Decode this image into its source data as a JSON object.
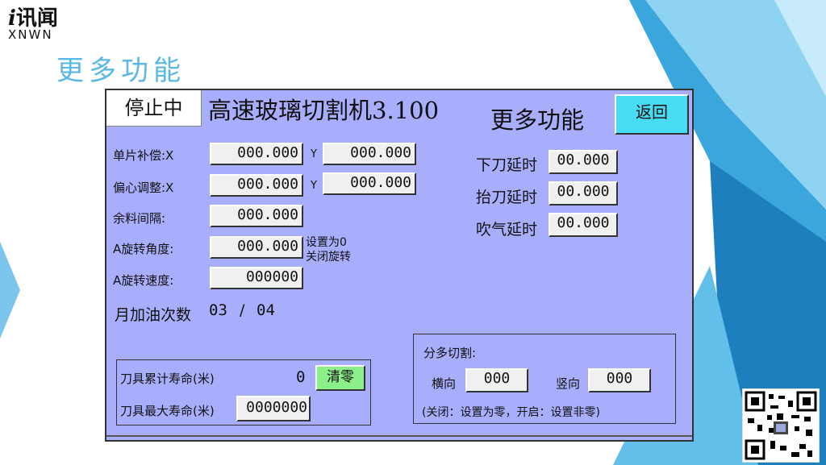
{
  "logo": {
    "main_i": "i",
    "main_text": "讯闻",
    "sub": "XNWN"
  },
  "slide_title": "更多功能",
  "hmi": {
    "status": "停止中",
    "machine_title": "高速玻璃切割机3.100",
    "page_label": "更多功能",
    "back_label": "返回",
    "single_comp": {
      "label": "单片补偿:X",
      "x": "000.000",
      "y_label": "Y",
      "y": "000.000"
    },
    "eccentric": {
      "label": "偏心调整:X",
      "x": "000.000",
      "y_label": "Y",
      "y": "000.000"
    },
    "margin": {
      "label": "余料间隔:",
      "value": "000.000"
    },
    "rot_angle": {
      "label": "A旋转角度:",
      "value": "000.000",
      "note1": "设置为0",
      "note2": "关闭旋转"
    },
    "rot_speed": {
      "label": "A旋转速度:",
      "value": "000000"
    },
    "oil": {
      "label": "月加油次数",
      "current": "03",
      "sep": "/",
      "total": "04"
    },
    "knife_down": {
      "label": "下刀延时",
      "value": "00.000"
    },
    "knife_up": {
      "label": "抬刀延时",
      "value": "00.000"
    },
    "blow": {
      "label": "吹气延时",
      "value": "00.000"
    },
    "life": {
      "total_label": "刀具累计寿命(米)",
      "total_value": "0",
      "clear_label": "清零",
      "max_label": "刀具最大寿命(米)",
      "max_value": "0000000"
    },
    "multi_cut": {
      "title": "分多切割:",
      "h_label": "横向",
      "h_value": "000",
      "v_label": "竖向",
      "v_value": "000",
      "note": "(关闭：设置为零，开启：设置非零)"
    }
  },
  "colors": {
    "panel": "#a9aefc",
    "back_button": "#47dcf4",
    "clear_button": "#8cf08a",
    "title": "#5ab8e6"
  },
  "icons": {
    "qr": "qr-code-icon"
  }
}
